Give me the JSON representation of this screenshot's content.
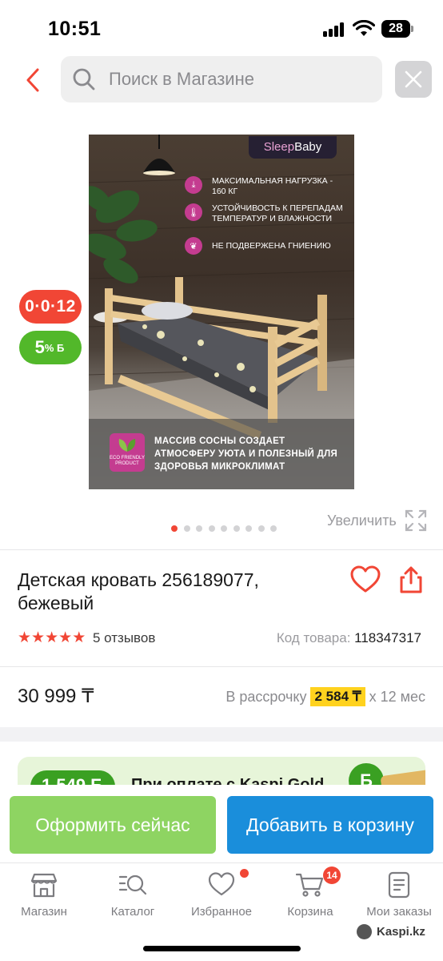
{
  "status_bar": {
    "time": "10:51",
    "battery": "28"
  },
  "search": {
    "placeholder": "Поиск в Магазине"
  },
  "product_image": {
    "brand_part1": "Sleep",
    "brand_part2": "Baby",
    "features": [
      "МАКСИМАЛЬНАЯ НАГРУЗКА - 160 КГ",
      "УСТОЙЧИВОСТЬ К ПЕРЕПАДАМ ТЕМПЕРАТУР И ВЛАЖНОСТИ",
      "НЕ ПОДВЕРЖЕНА ГНИЕНИЮ"
    ],
    "eco_label": "ECO FRIENDLY PRODUCT",
    "caption": "МАССИВ СОСНЫ СОЗДАЕТ АТМОСФЕРУ УЮТА И ПОЛЕЗНЫЙ ДЛЯ ЗДОРОВЬЯ МИКРОКЛИМАТ"
  },
  "badges": {
    "installment": "0·0·12",
    "bonus_value": "5",
    "bonus_suffix": "% Б"
  },
  "zoom": {
    "label": "Увеличить"
  },
  "pager": {
    "count": 9,
    "active": 1
  },
  "product": {
    "title": "Детская кровать 256189077, бежевый",
    "rating": 5,
    "reviews": "5 отзывов",
    "sku_label": "Код товара:",
    "sku_value": "118347317"
  },
  "price": {
    "value": "30 999 ₸",
    "installment_prefix": "В рассрочку",
    "installment_amount": "2 584 ₸",
    "installment_suffix": "x 12 мес"
  },
  "gold_promo": {
    "amount": "1 549 Б",
    "text": "При оплате с Kaspi Gold"
  },
  "actions": {
    "checkout": "Оформить сейчас",
    "add_to_cart": "Добавить в корзину"
  },
  "tabs": [
    {
      "label": "Магазин",
      "icon": "store-icon"
    },
    {
      "label": "Каталог",
      "icon": "catalog-search-icon"
    },
    {
      "label": "Избранное",
      "icon": "heart-icon"
    },
    {
      "label": "Корзина",
      "icon": "cart-icon"
    },
    {
      "label": "Мои заказы",
      "icon": "orders-icon"
    }
  ],
  "cart_count": "14",
  "watermark": "Kaspi.kz",
  "colors": {
    "accent_red": "#f14635",
    "green": "#52b82a",
    "blue": "#1a8edb",
    "yellow": "#ffd21e"
  }
}
